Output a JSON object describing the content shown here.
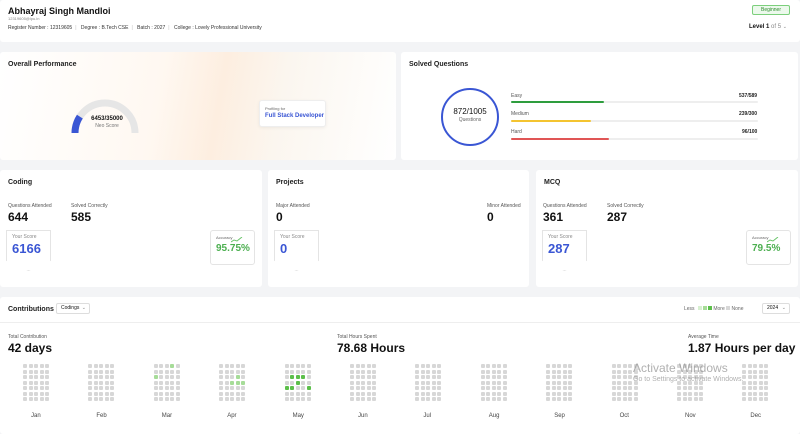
{
  "header": {
    "name": "Abhayraj Singh Mandloi",
    "email": "12319605@lpu.in",
    "reg_label": "Register Number :",
    "reg_value": "12319605",
    "degree_label": "Degree :",
    "degree_value": "B.Tech CSE",
    "batch_label": "Batch :",
    "batch_value": "2027",
    "college_label": "College :",
    "college_value": "Lovely Professional University",
    "badge": "Beginner",
    "level_label": "Level",
    "level_value": "1",
    "level_of": "of 5"
  },
  "performance": {
    "title": "Overall Performance",
    "score": "6453/35000",
    "score_label": "Neo Score",
    "score_fraction": 0.184,
    "profiling_label": "Profiling for",
    "profiling_value": "Full Stack Developer"
  },
  "solved": {
    "title": "Solved Questions",
    "total": "872/1005",
    "total_label": "Questions",
    "rows": [
      {
        "label": "Easy",
        "value": "537/589",
        "fraction": 0.91,
        "color": "#2e9d3e"
      },
      {
        "label": "Medium",
        "value": "239/300",
        "fraction": 0.8,
        "color": "#f4c430"
      },
      {
        "label": "Hard",
        "value": "96/100",
        "fraction": 0.96,
        "color": "#e05555"
      }
    ]
  },
  "coding": {
    "title": "Coding",
    "attended_label": "Questions Attended",
    "attended": "644",
    "correct_label": "Solved Correctly",
    "correct": "585",
    "score_label": "Your Score",
    "score": "6166",
    "accuracy_label": "Accuracy",
    "accuracy": "95.75%"
  },
  "projects": {
    "title": "Projects",
    "major_label": "Major Attended",
    "major": "0",
    "minor_label": "Minor Attended",
    "minor": "0",
    "score_label": "Your Score",
    "score": "0"
  },
  "mcq": {
    "title": "MCQ",
    "attended_label": "Questions Attended",
    "attended": "361",
    "correct_label": "Solved Correctly",
    "correct": "287",
    "score_label": "Your Score",
    "score": "287",
    "accuracy_label": "Accuracy",
    "accuracy": "79.5%"
  },
  "contributions": {
    "title": "Contributions",
    "filter": "Codings",
    "legend_less": "Less",
    "legend_more": "More",
    "legend_none": "None",
    "year": "2024",
    "total_label": "Total Contribution",
    "total": "42 days",
    "hours_label": "Total Hours Spent",
    "hours": "78.68 Hours",
    "avg_label": "Average Time",
    "avg": "1.87 Hours per day",
    "months": [
      "Jan",
      "Feb",
      "Mar",
      "Apr",
      "May",
      "Jun",
      "Jul",
      "Aug",
      "Sep",
      "Oct",
      "Nov",
      "Dec"
    ]
  },
  "watermark": {
    "line1": "Activate Windows",
    "line2": "Go to Settings to activate Windows."
  }
}
